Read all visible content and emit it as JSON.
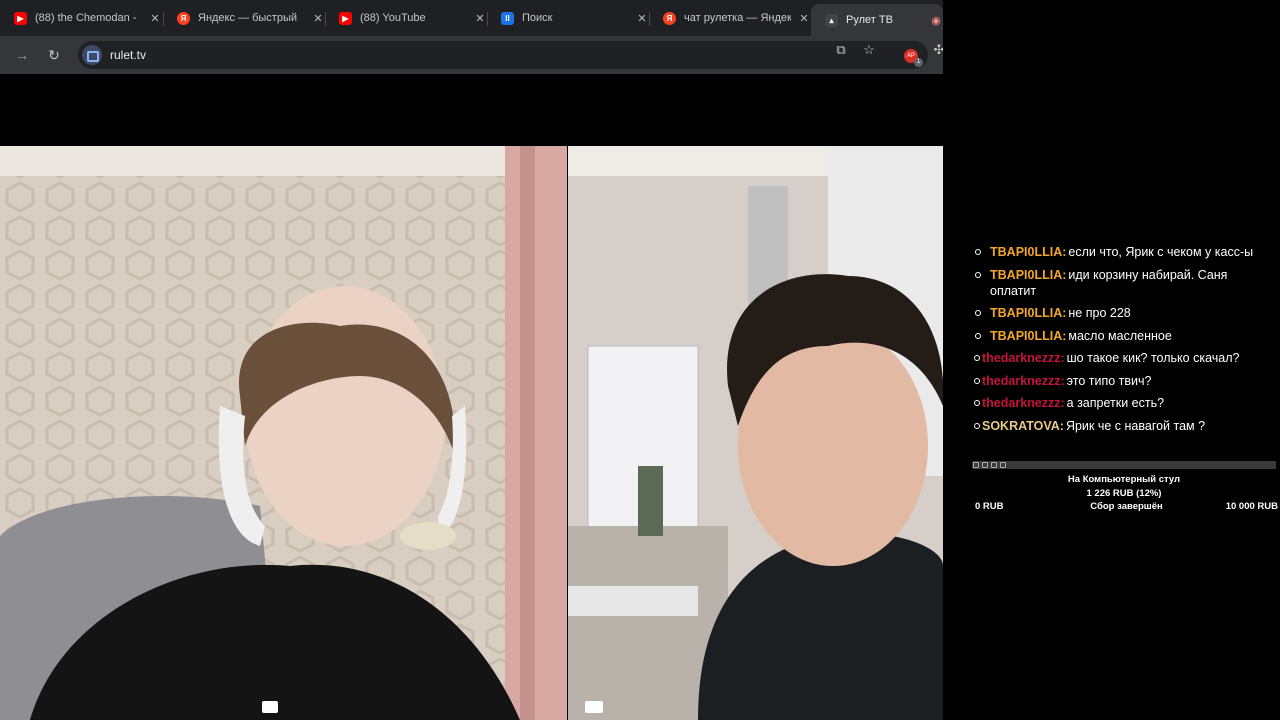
{
  "browser": {
    "tabs": [
      {
        "title": "(88) the Chemodan -",
        "favicon": "youtube-icon",
        "color": "#ff0000"
      },
      {
        "title": "Яндекс — быстрый",
        "favicon": "yandex-icon",
        "color": "#fc3f1d"
      },
      {
        "title": "(88) YouTube",
        "favicon": "youtube-icon",
        "color": "#ff0000"
      },
      {
        "title": "Поиск",
        "favicon": "pause-icon",
        "color": "#1a73e8"
      },
      {
        "title": "чат рулетка — Яндек",
        "favicon": "yandex-icon",
        "color": "#fc3f1d"
      },
      {
        "title": "Рулет ТВ",
        "favicon": "rulet-icon",
        "color": "#444444"
      }
    ],
    "url": "rulet.tv",
    "extension_badge": "1"
  },
  "chat": {
    "messages": [
      {
        "user": "TBAPI0LLIA:",
        "text": "если что, Ярик с чеком у касс-ы",
        "style": "orange"
      },
      {
        "user": "TBAPI0LLIA:",
        "text": "иди корзину набирай. Саня оплатит",
        "style": "orange"
      },
      {
        "user": "TBAPI0LLIA:",
        "text": "не про 228",
        "style": "orange"
      },
      {
        "user": "TBAPI0LLIA:",
        "text": "масло масленное",
        "style": "orange"
      },
      {
        "user": "thedarknezzz:",
        "text": "шо такое кик? только скачал?",
        "style": "red"
      },
      {
        "user": "thedarknezzz:",
        "text": "это типо твич?",
        "style": "red"
      },
      {
        "user": "thedarknezzz:",
        "text": "а запретки есть?",
        "style": "red"
      },
      {
        "user": "SOKRATOVA:",
        "text": "Ярик че с навагой там ?",
        "style": "gold"
      }
    ]
  },
  "donation_goal": {
    "title": "На Компьютерный стул",
    "amount": "1 226 RUB (12%)",
    "progress_percent": 12,
    "min": "0 RUB",
    "status": "Сбор завершён",
    "max": "10 000 RUB"
  }
}
